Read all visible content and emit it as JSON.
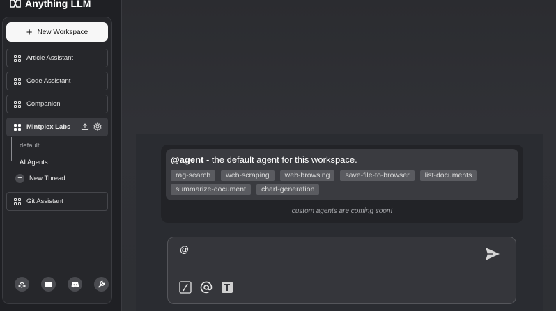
{
  "app": {
    "title": "Anything LLM"
  },
  "sidebar": {
    "new_workspace_label": "New Workspace",
    "workspaces": [
      {
        "label": "Article Assistant"
      },
      {
        "label": "Code Assistant"
      },
      {
        "label": "Companion"
      },
      {
        "label": "Mintplex Labs",
        "active": true
      },
      {
        "label": "Git Assistant"
      }
    ],
    "threads": [
      {
        "label": "default"
      },
      {
        "label": "AI Agents"
      }
    ],
    "new_thread_label": "New Thread",
    "footer_icons": [
      "community-icon",
      "book-icon",
      "discord-icon",
      "wrench-icon"
    ]
  },
  "agent_popup": {
    "handle": "@agent",
    "description": " - the default agent for this workspace.",
    "skills": [
      "rag-search",
      "web-scraping",
      "web-browsing",
      "save-file-to-browser",
      "list-documents",
      "summarize-document",
      "chart-generation"
    ],
    "footer": "custom agents are coming soon!"
  },
  "prompt": {
    "value": "@",
    "tools": [
      "slash-command-icon",
      "at-mention-icon",
      "text-size-icon"
    ]
  }
}
